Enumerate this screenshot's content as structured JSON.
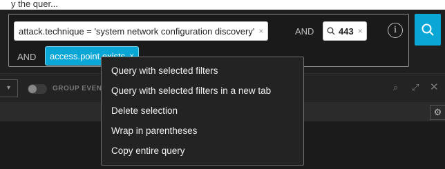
{
  "caption": "y the quer...",
  "query": {
    "filter_main": "attack.technique = 'system network configuration discovery'",
    "operator_1": "AND",
    "search_value": "443",
    "operator_2": "AND",
    "selected_filter": "access.point.exists",
    "remove_glyph": "×",
    "info_glyph": "i"
  },
  "toolbar": {
    "dropdown_glyph": "▾",
    "group_label": "GROUP EVENTS",
    "search_glyph": "⌕",
    "expand_glyph": "⤢",
    "close_glyph": "✕"
  },
  "grid": {
    "gear_glyph": "⚙"
  },
  "context_menu": {
    "items": [
      "Query with selected filters",
      "Query with selected filters in a new tab",
      "Delete selection",
      "Wrap in parentheses",
      "Copy entire query"
    ]
  },
  "colors": {
    "accent": "#0aa6d6",
    "background": "#1f1f1f",
    "menu_bg": "#232323"
  }
}
